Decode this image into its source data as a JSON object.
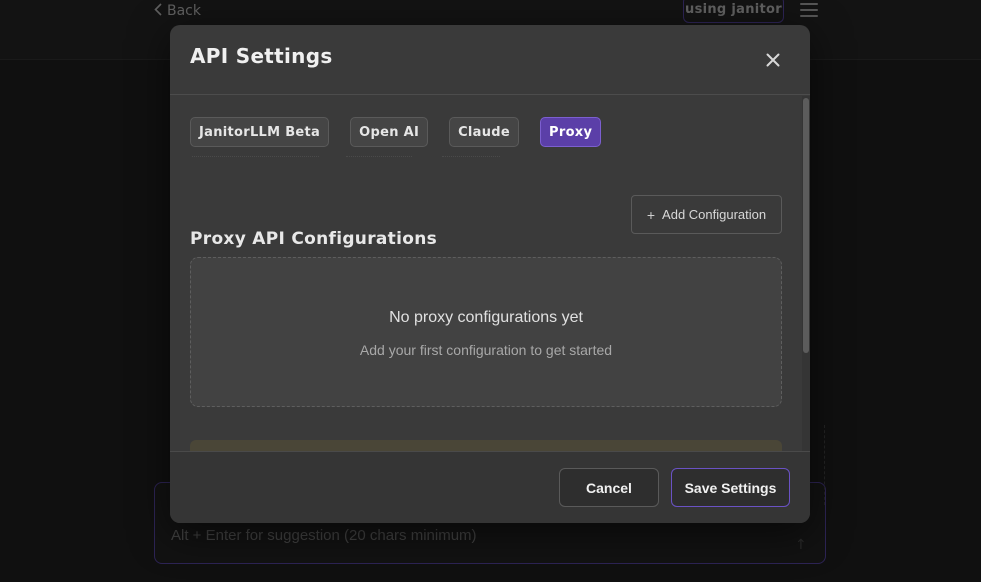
{
  "background": {
    "back_label": "Back",
    "using_badge": "using janitor",
    "chat_placeholder": "Alt + Enter for suggestion (20 chars minimum)"
  },
  "modal": {
    "title": "API Settings",
    "tabs": [
      {
        "label": "JanitorLLM Beta",
        "active": false
      },
      {
        "label": "Open AI",
        "active": false
      },
      {
        "label": "Claude",
        "active": false
      },
      {
        "label": "Proxy",
        "active": true
      }
    ],
    "section_title": "Proxy API Configurations",
    "add_config_label": "Add Configuration",
    "empty_state": {
      "title": "No proxy configurations yet",
      "subtitle": "Add your first configuration to get started"
    },
    "footer": {
      "cancel_label": "Cancel",
      "save_label": "Save Settings"
    }
  },
  "colors": {
    "accent": "#5b3fa8",
    "accent_border": "#6a52c4",
    "modal_bg": "#3a3a3a",
    "page_bg": "#1a1a1a"
  },
  "icons": [
    "chevron-left-icon",
    "hamburger-menu-icon",
    "close-icon",
    "plus-icon",
    "send-arrow-icon"
  ]
}
